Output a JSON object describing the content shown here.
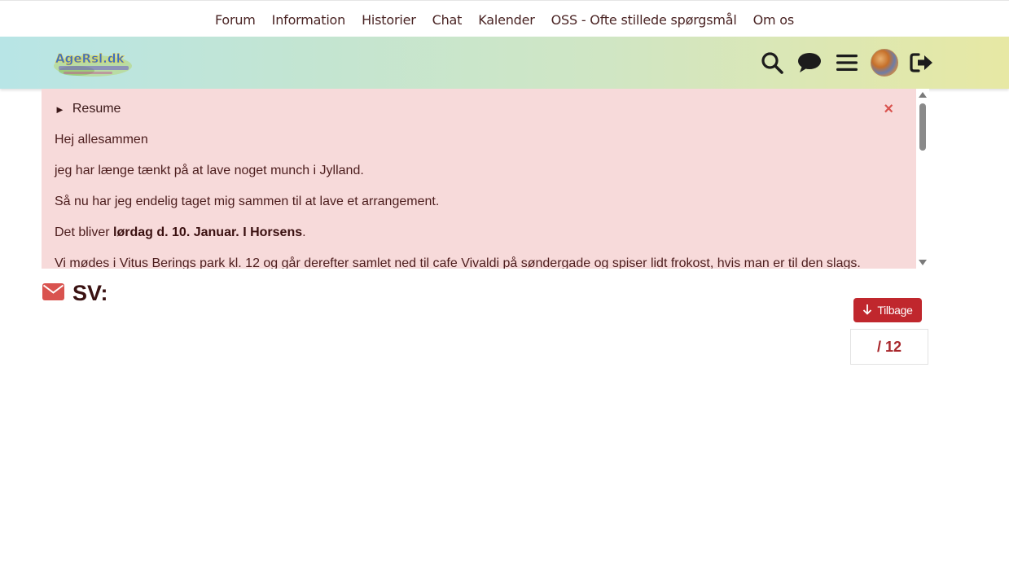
{
  "nav": {
    "items": [
      {
        "label": "Forum"
      },
      {
        "label": "Information"
      },
      {
        "label": "Historier"
      },
      {
        "label": "Chat"
      },
      {
        "label": "Kalender"
      },
      {
        "label": "OSS - Ofte stillede spørgsmål"
      },
      {
        "label": "Om os"
      }
    ]
  },
  "header": {
    "logo_text": "AgeRsl.dk",
    "icons": [
      "search-icon",
      "chat-bubble-icon",
      "menu-icon",
      "avatar",
      "logout-icon"
    ]
  },
  "panel": {
    "summary_label": "Resume",
    "close_glyph": "×",
    "lines": [
      "Hej allesammen",
      "jeg har længe tænkt på at lave noget munch i Jylland.",
      "Så nu har jeg endelig taget mig sammen til at lave et arrangement."
    ],
    "date_prefix": "Det bliver ",
    "date_bold": "lørdag d. 10. Januar. I Horsens",
    "date_suffix": ".",
    "cut_line": "Vi mødes i Vitus Berings park kl. 12 og går derefter samlet ned til cafe Vivaldi på søndergade og spiser lidt frokost, hvis man er til den slags."
  },
  "reply": {
    "title": "SV:"
  },
  "back_button": {
    "label": "Tilbage"
  },
  "pagination": {
    "text": "/ 12"
  },
  "colors": {
    "panel_bg": "#f7dada",
    "accent_red": "#c0272d",
    "envelope": "#d9534f",
    "page_number": "#a8262b"
  }
}
